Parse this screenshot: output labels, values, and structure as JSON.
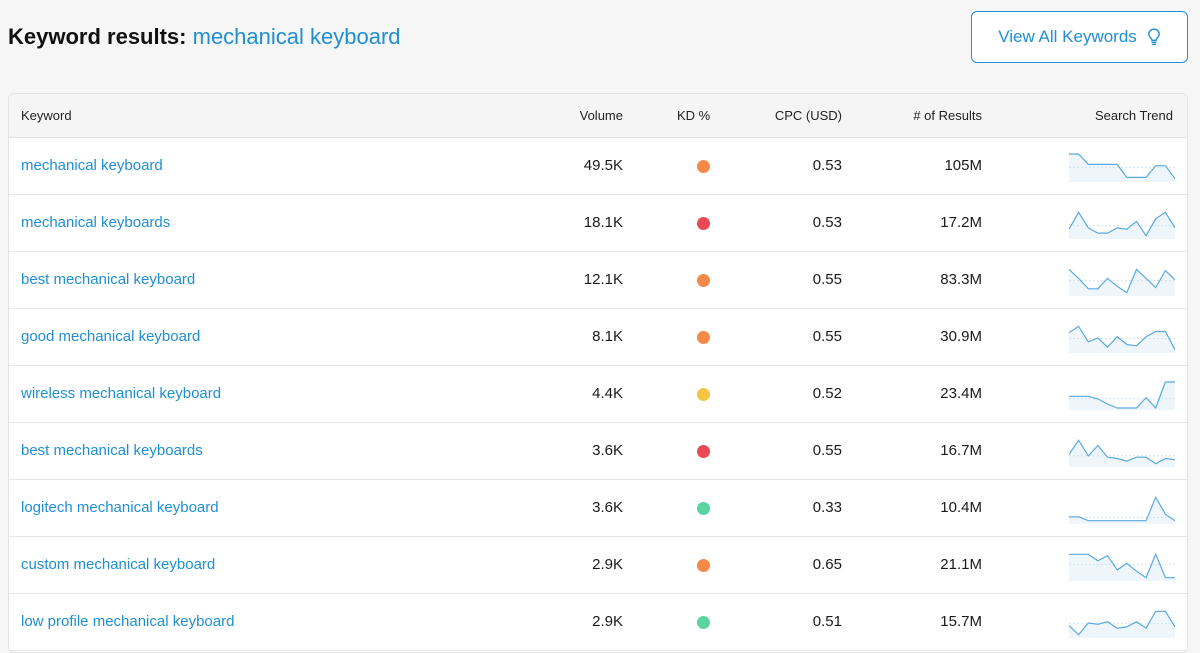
{
  "header": {
    "title_label": "Keyword results:",
    "title_query": "mechanical keyboard",
    "view_all_label": "View All Keywords"
  },
  "table": {
    "columns": {
      "keyword": "Keyword",
      "volume": "Volume",
      "kd": "KD %",
      "cpc": "CPC (USD)",
      "results": "# of Results",
      "trend": "Search Trend"
    },
    "colors": {
      "link": "#1f8fd3",
      "kd_orange": "#f5894a",
      "kd_red": "#e84a55",
      "kd_yellow": "#f4c442",
      "kd_green": "#5ad4a0",
      "trend_line": "#5aa9e0",
      "trend_fill": "#eef6fc"
    },
    "rows": [
      {
        "keyword": "mechanical keyboard",
        "volume": "49.5K",
        "kd_color": "#f5894a",
        "cpc": "0.53",
        "results": "105M",
        "trend": [
          1,
          1,
          0.6,
          0.6,
          0.6,
          0.6,
          0.1,
          0.1,
          0.1,
          0.55,
          0.55,
          0.05
        ]
      },
      {
        "keyword": "mechanical keyboards",
        "volume": "18.1K",
        "kd_color": "#e84a55",
        "cpc": "0.53",
        "results": "17.2M",
        "trend": [
          0.3,
          0.95,
          0.35,
          0.15,
          0.15,
          0.35,
          0.3,
          0.6,
          0.05,
          0.7,
          0.95,
          0.35
        ]
      },
      {
        "keyword": "best mechanical keyboard",
        "volume": "12.1K",
        "kd_color": "#f5894a",
        "cpc": "0.55",
        "results": "83.3M",
        "trend": [
          0.95,
          0.6,
          0.2,
          0.2,
          0.6,
          0.3,
          0.05,
          0.95,
          0.6,
          0.25,
          0.9,
          0.55
        ]
      },
      {
        "keyword": "good mechanical keyboard",
        "volume": "8.1K",
        "kd_color": "#f5894a",
        "cpc": "0.55",
        "results": "30.9M",
        "trend": [
          0.7,
          0.95,
          0.35,
          0.5,
          0.15,
          0.55,
          0.25,
          0.2,
          0.55,
          0.75,
          0.75,
          0.05
        ]
      },
      {
        "keyword": "wireless mechanical keyboard",
        "volume": "4.4K",
        "kd_color": "#f4c442",
        "cpc": "0.52",
        "results": "23.4M",
        "trend": [
          0.45,
          0.45,
          0.45,
          0.35,
          0.15,
          0.0,
          0.0,
          0.0,
          0.4,
          0.0,
          1.0,
          1.0
        ]
      },
      {
        "keyword": "best mechanical keyboards",
        "volume": "3.6K",
        "kd_color": "#e84a55",
        "cpc": "0.55",
        "results": "16.7M",
        "trend": [
          0.4,
          0.95,
          0.35,
          0.75,
          0.3,
          0.25,
          0.15,
          0.3,
          0.3,
          0.05,
          0.25,
          0.2
        ]
      },
      {
        "keyword": "logitech mechanical keyboard",
        "volume": "3.6K",
        "kd_color": "#5ad4a0",
        "cpc": "0.33",
        "results": "10.4M",
        "trend": [
          0.2,
          0.2,
          0.05,
          0.05,
          0.05,
          0.05,
          0.05,
          0.05,
          0.05,
          0.95,
          0.3,
          0.05
        ]
      },
      {
        "keyword": "custom mechanical keyboard",
        "volume": "2.9K",
        "kd_color": "#f5894a",
        "cpc": "0.65",
        "results": "21.1M",
        "trend": [
          0.95,
          0.95,
          0.95,
          0.7,
          0.9,
          0.35,
          0.6,
          0.3,
          0.05,
          0.95,
          0.05,
          0.05
        ]
      },
      {
        "keyword": "low profile mechanical keyboard",
        "volume": "2.9K",
        "kd_color": "#5ad4a0",
        "cpc": "0.51",
        "results": "15.7M",
        "trend": [
          0.4,
          0.05,
          0.5,
          0.45,
          0.55,
          0.3,
          0.35,
          0.55,
          0.3,
          0.95,
          0.95,
          0.35
        ]
      }
    ]
  }
}
